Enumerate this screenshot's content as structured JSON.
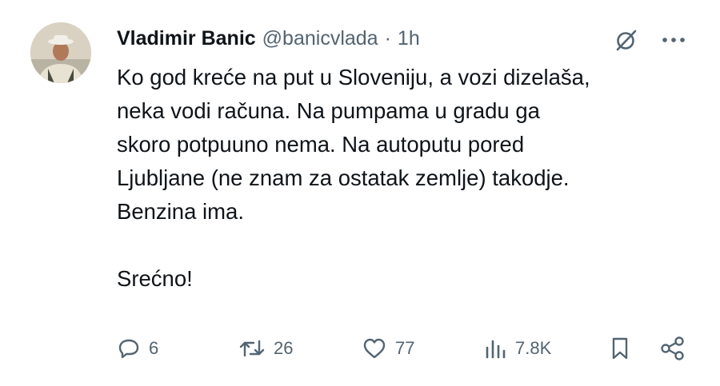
{
  "author": {
    "name": "Vladimir Banic",
    "handle": "@banicvlada",
    "separator": "·",
    "time": "1h"
  },
  "tweet": {
    "lines": [
      "Ko god kreće na put u Sloveniju, a vozi dizelaša,",
      "neka vodi računa. Na pumpama u gradu ga",
      "skoro potpuuno nema. Na autoputu pored",
      "Ljubljane (ne znam za ostatak zemlje) takodje.",
      "Benzina ima.",
      "Srećno!"
    ]
  },
  "actions": {
    "replies": "6",
    "reposts": "26",
    "likes": "77",
    "views": "7.8K"
  },
  "icons": {
    "grok": "grok-icon",
    "more": "more-icon",
    "reply": "reply-icon",
    "repost": "repost-icon",
    "like": "like-icon",
    "views": "views-icon",
    "bookmark": "bookmark-icon",
    "share": "share-icon"
  },
  "colors": {
    "text": "#0f1419",
    "secondary": "#536471",
    "background": "#ffffff"
  }
}
